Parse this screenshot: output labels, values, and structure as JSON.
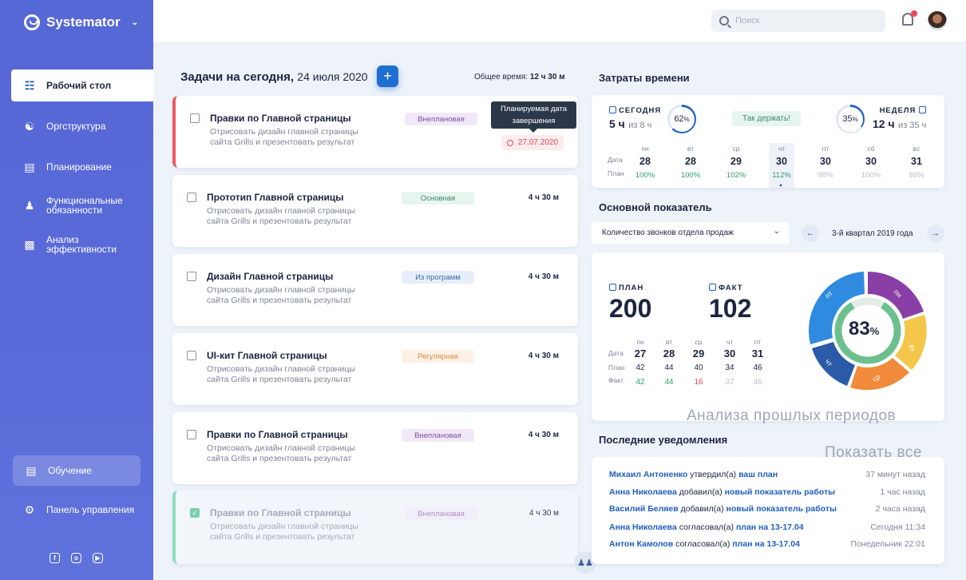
{
  "app": {
    "name": "Systemator"
  },
  "sidebar": {
    "items": [
      {
        "label": "Рабочий стол",
        "icon": "grid-icon"
      },
      {
        "label": "Оргструктура",
        "icon": "org-icon"
      },
      {
        "label": "Планирование",
        "icon": "calendar-icon"
      },
      {
        "label": "Функциональные обязанности",
        "icon": "people-icon"
      },
      {
        "label": "Анализ эффективности",
        "icon": "bar-chart-icon"
      }
    ],
    "learn": "Обучение",
    "panel": "Панель управления",
    "social": [
      "facebook-icon",
      "instagram-icon",
      "youtube-icon"
    ]
  },
  "header": {
    "search_placeholder": "Поиск"
  },
  "tasks": {
    "title": "Задачи на сегодня,",
    "date": "24 июля 2020",
    "total_label": "Общее время:",
    "total_value": "12 ч 30 м",
    "tooltip": "Планируемая дата завершения",
    "due": "27.07.2020",
    "items": [
      {
        "title": "Правки по Главной страницы",
        "desc": "Отрисовать дизайн главной страницы сайта Grills и презентовать результат",
        "badge": "Внеплановая",
        "time": ""
      },
      {
        "title": "Прототип Главной страницы",
        "desc": "Отрисовать дизайн главной страницы сайта Grills и презентовать результат",
        "badge": "Основная",
        "time": "4 ч 30 м"
      },
      {
        "title": "Дизайн Главной страницы",
        "desc": "Отрисовать дизайн главной страницы сайта Grills и презентовать результат",
        "badge": "Из программ",
        "time": "4 ч 30 м"
      },
      {
        "title": "UI-кит Главной страницы",
        "desc": "Отрисовать дизайн главной страницы сайта Grills и презентовать результат",
        "badge": "Регулярная",
        "time": "4 ч 30 м"
      },
      {
        "title": "Правки по Главной страницы",
        "desc": "Отрисовать дизайн главной страницы сайта Grills и презентовать результат",
        "badge": "Внеплановая",
        "time": "4 ч 30 м"
      },
      {
        "title": "Правки по Главной страницы",
        "desc": "Отрисовать дизайн главной страницы сайта Grills и презентовать результат",
        "badge": "Внеплановая",
        "time": "4 ч 30 м"
      }
    ]
  },
  "time": {
    "title": "Затраты времени",
    "today_label": "СЕГОДНЯ",
    "today_value": "5 ч",
    "today_of": "из 8 ч",
    "today_pct": "62",
    "keep": "Так держать!",
    "week_label": "НЕДЕЛЯ",
    "week_value": "12 ч",
    "week_of": "из 35 ч",
    "week_pct": "35",
    "pct_sign": "%",
    "row_date": "Дата",
    "row_plan": "План",
    "days": [
      {
        "d": "пн",
        "n": "28",
        "p": "100%"
      },
      {
        "d": "вт",
        "n": "28",
        "p": "100%"
      },
      {
        "d": "ср",
        "n": "29",
        "p": "102%"
      },
      {
        "d": "чт",
        "n": "30",
        "p": "112%"
      },
      {
        "d": "пт",
        "n": "30",
        "p": "98%"
      },
      {
        "d": "сб",
        "n": "30",
        "p": "100%"
      },
      {
        "d": "вс",
        "n": "31",
        "p": "86%"
      }
    ]
  },
  "kpi": {
    "title": "Основной показатель",
    "select": "Количество звонков отдела продаж",
    "period": "3-й квартал 2019 года",
    "plan_label": "ПЛАН",
    "plan": "200",
    "fact_label": "ФАКТ",
    "fact": "102",
    "row_date": "Дата",
    "row_plan": "План",
    "row_fact": "Факт",
    "days": [
      {
        "d": "пн",
        "n": "27",
        "p": "42",
        "f": "42"
      },
      {
        "d": "вт",
        "n": "28",
        "p": "44",
        "f": "44"
      },
      {
        "d": "ср",
        "n": "29",
        "p": "40",
        "f": "16"
      },
      {
        "d": "чт",
        "n": "30",
        "p": "34",
        "f": "37"
      },
      {
        "d": "пт",
        "n": "31",
        "p": "46",
        "f": "46"
      }
    ],
    "donut_pct": "83",
    "donut_labels": [
      "пн",
      "вт",
      "ср",
      "чт",
      "пт"
    ],
    "ghost": "Анализа прошлых периодов"
  },
  "notif": {
    "title": "Последние уведомления",
    "ghost": "Показать все",
    "items": [
      {
        "user": "Михаил Антоненко",
        "action": "утвердил(а)",
        "link": "ваш план",
        "time": "37 минут назад"
      },
      {
        "user": "Анна Николаева",
        "action": "добавил(а)",
        "link": "новый показатель работы",
        "time": "1 час назад"
      },
      {
        "user": "Василий Беляев",
        "action": "добавил(а)",
        "link": "новый показатель работы",
        "time": "2 часа назад"
      },
      {
        "user": "Анна Николаева",
        "action": "согласовал(а)",
        "link": "план на 13-17.04",
        "time": "Сегодня 11:34"
      },
      {
        "user": "Антон Камолов",
        "action": "согласовал(а)",
        "link": "план на 13-17.04",
        "time": "Понедельник 22:01"
      }
    ]
  }
}
